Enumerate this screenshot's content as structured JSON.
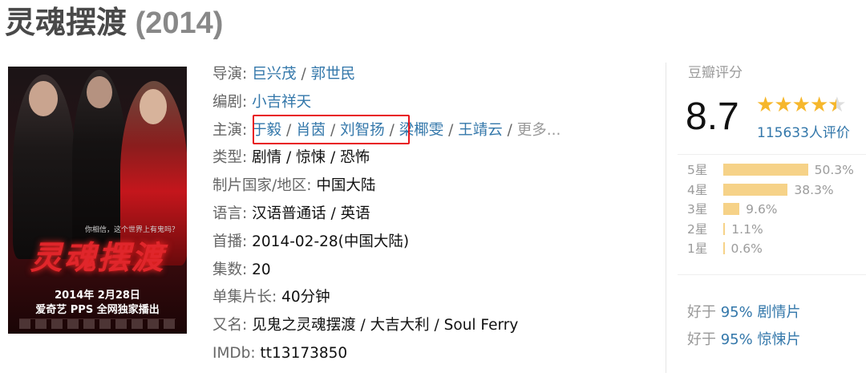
{
  "title": {
    "name": "灵魂摆渡",
    "year": "(2014)"
  },
  "poster": {
    "tagline": "你相信，这个世界上有鬼吗？",
    "logo_text": "灵魂摆渡",
    "release_line1": "2014年 2月28日",
    "release_line2": "爱奇艺 PPS 全网独家播出"
  },
  "info": {
    "director_label": "导演",
    "directors": [
      "巨兴茂",
      "郭世民"
    ],
    "writer_label": "编剧",
    "writers": [
      "小吉祥天"
    ],
    "cast_label": "主演",
    "cast": [
      "于毅",
      "肖茵",
      "刘智扬",
      "梁椰雯",
      "王靖云"
    ],
    "cast_more": "更多...",
    "genre_label": "类型",
    "genres": "剧情 / 惊悚 / 恐怖",
    "country_label": "制片国家/地区",
    "country": "中国大陆",
    "language_label": "语言",
    "language": "汉语普通话 / 英语",
    "premiere_label": "首播",
    "premiere": "2014-02-28(中国大陆)",
    "episodes_label": "集数",
    "episodes": "20",
    "runtime_label": "单集片长",
    "runtime": "40分钟",
    "aka_label": "又名",
    "aka": "见鬼之灵魂摆渡 / 大吉大利 / Soul Ferry",
    "imdb_label": "IMDb",
    "imdb": "tt13173850"
  },
  "rating": {
    "title": "豆瓣评分",
    "score": "8.7",
    "stars_value": 4.5,
    "votes": "115633人评价",
    "distribution": [
      {
        "label": "5星",
        "pct": "50.3%",
        "value": 50.3
      },
      {
        "label": "4星",
        "pct": "38.3%",
        "value": 38.3
      },
      {
        "label": "3星",
        "pct": "9.6%",
        "value": 9.6
      },
      {
        "label": "2星",
        "pct": "1.1%",
        "value": 1.1
      },
      {
        "label": "1星",
        "pct": "0.6%",
        "value": 0.6
      }
    ],
    "better_than": [
      {
        "prefix": "好于",
        "link": "95% 剧情片"
      },
      {
        "prefix": "好于",
        "link": "95% 惊悚片"
      }
    ]
  },
  "colors": {
    "link": "#3377aa",
    "star": "#f6b72c",
    "bar": "#f6d288",
    "highlight_box": "#e8141b"
  }
}
